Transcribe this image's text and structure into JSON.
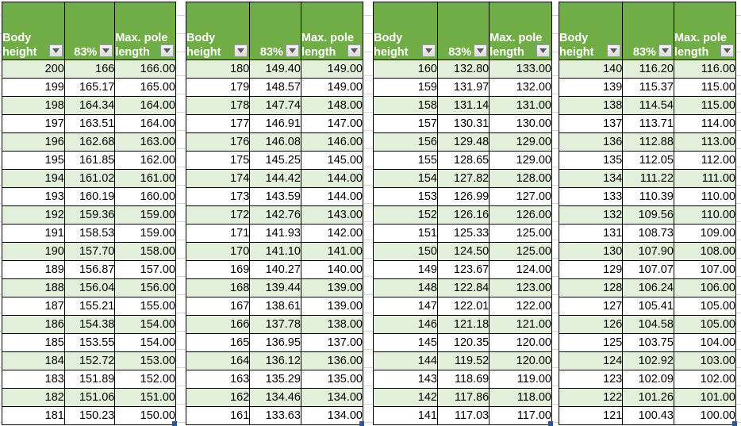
{
  "app": {
    "type": "spreadsheet",
    "colors": {
      "header_green": "#70AD47",
      "band_green": "#E2EFDA",
      "row_white": "#FFFFFF",
      "grid_line": "#000000",
      "fill_handle_blue": "#2F5597"
    }
  },
  "columns": {
    "body_height": "Body height",
    "percent": "83%",
    "max_pole_length": "Max. pole length",
    "filter_icon": "filter-dropdown-icon"
  },
  "tables": [
    {
      "id": "table-1",
      "headers": [
        "Body height",
        "83%",
        "Max. pole length"
      ],
      "rows": [
        [
          "200",
          "166",
          "166.00"
        ],
        [
          "199",
          "165.17",
          "165.00"
        ],
        [
          "198",
          "164.34",
          "164.00"
        ],
        [
          "197",
          "163.51",
          "164.00"
        ],
        [
          "196",
          "162.68",
          "163.00"
        ],
        [
          "195",
          "161.85",
          "162.00"
        ],
        [
          "194",
          "161.02",
          "161.00"
        ],
        [
          "193",
          "160.19",
          "160.00"
        ],
        [
          "192",
          "159.36",
          "159.00"
        ],
        [
          "191",
          "158.53",
          "159.00"
        ],
        [
          "190",
          "157.70",
          "158.00"
        ],
        [
          "189",
          "156.87",
          "157.00"
        ],
        [
          "188",
          "156.04",
          "156.00"
        ],
        [
          "187",
          "155.21",
          "155.00"
        ],
        [
          "186",
          "154.38",
          "154.00"
        ],
        [
          "185",
          "153.55",
          "154.00"
        ],
        [
          "184",
          "152.72",
          "153.00"
        ],
        [
          "183",
          "151.89",
          "152.00"
        ],
        [
          "182",
          "151.06",
          "151.00"
        ],
        [
          "181",
          "150.23",
          "150.00"
        ]
      ]
    },
    {
      "id": "table-2",
      "headers": [
        "Body height",
        "83%",
        "Max. pole length"
      ],
      "rows": [
        [
          "180",
          "149.40",
          "149.00"
        ],
        [
          "179",
          "148.57",
          "149.00"
        ],
        [
          "178",
          "147.74",
          "148.00"
        ],
        [
          "177",
          "146.91",
          "147.00"
        ],
        [
          "176",
          "146.08",
          "146.00"
        ],
        [
          "175",
          "145.25",
          "145.00"
        ],
        [
          "174",
          "144.42",
          "144.00"
        ],
        [
          "173",
          "143.59",
          "144.00"
        ],
        [
          "172",
          "142.76",
          "143.00"
        ],
        [
          "171",
          "141.93",
          "142.00"
        ],
        [
          "170",
          "141.10",
          "141.00"
        ],
        [
          "169",
          "140.27",
          "140.00"
        ],
        [
          "168",
          "139.44",
          "139.00"
        ],
        [
          "167",
          "138.61",
          "139.00"
        ],
        [
          "166",
          "137.78",
          "138.00"
        ],
        [
          "165",
          "136.95",
          "137.00"
        ],
        [
          "164",
          "136.12",
          "136.00"
        ],
        [
          "163",
          "135.29",
          "135.00"
        ],
        [
          "162",
          "134.46",
          "134.00"
        ],
        [
          "161",
          "133.63",
          "134.00"
        ]
      ]
    },
    {
      "id": "table-3",
      "headers": [
        "Body height",
        "83%",
        "Max. pole length"
      ],
      "rows": [
        [
          "160",
          "132.80",
          "133.00"
        ],
        [
          "159",
          "131.97",
          "132.00"
        ],
        [
          "158",
          "131.14",
          "131.00"
        ],
        [
          "157",
          "130.31",
          "130.00"
        ],
        [
          "156",
          "129.48",
          "129.00"
        ],
        [
          "155",
          "128.65",
          "129.00"
        ],
        [
          "154",
          "127.82",
          "128.00"
        ],
        [
          "153",
          "126.99",
          "127.00"
        ],
        [
          "152",
          "126.16",
          "126.00"
        ],
        [
          "151",
          "125.33",
          "125.00"
        ],
        [
          "150",
          "124.50",
          "125.00"
        ],
        [
          "149",
          "123.67",
          "124.00"
        ],
        [
          "148",
          "122.84",
          "123.00"
        ],
        [
          "147",
          "122.01",
          "122.00"
        ],
        [
          "146",
          "121.18",
          "121.00"
        ],
        [
          "145",
          "120.35",
          "120.00"
        ],
        [
          "144",
          "119.52",
          "120.00"
        ],
        [
          "143",
          "118.69",
          "119.00"
        ],
        [
          "142",
          "117.86",
          "118.00"
        ],
        [
          "141",
          "117.03",
          "117.00"
        ]
      ]
    },
    {
      "id": "table-4",
      "headers": [
        "Body height",
        "83%",
        "Max. pole length"
      ],
      "rows": [
        [
          "140",
          "116.20",
          "116.00"
        ],
        [
          "139",
          "115.37",
          "115.00"
        ],
        [
          "138",
          "114.54",
          "115.00"
        ],
        [
          "137",
          "113.71",
          "114.00"
        ],
        [
          "136",
          "112.88",
          "113.00"
        ],
        [
          "135",
          "112.05",
          "112.00"
        ],
        [
          "134",
          "111.22",
          "111.00"
        ],
        [
          "133",
          "110.39",
          "110.00"
        ],
        [
          "132",
          "109.56",
          "110.00"
        ],
        [
          "131",
          "108.73",
          "109.00"
        ],
        [
          "130",
          "107.90",
          "108.00"
        ],
        [
          "129",
          "107.07",
          "107.00"
        ],
        [
          "128",
          "106.24",
          "106.00"
        ],
        [
          "127",
          "105.41",
          "105.00"
        ],
        [
          "126",
          "104.58",
          "105.00"
        ],
        [
          "125",
          "103.75",
          "104.00"
        ],
        [
          "124",
          "102.92",
          "103.00"
        ],
        [
          "123",
          "102.09",
          "102.00"
        ],
        [
          "122",
          "101.26",
          "101.00"
        ],
        [
          "121",
          "100.43",
          "100.00"
        ]
      ]
    }
  ]
}
